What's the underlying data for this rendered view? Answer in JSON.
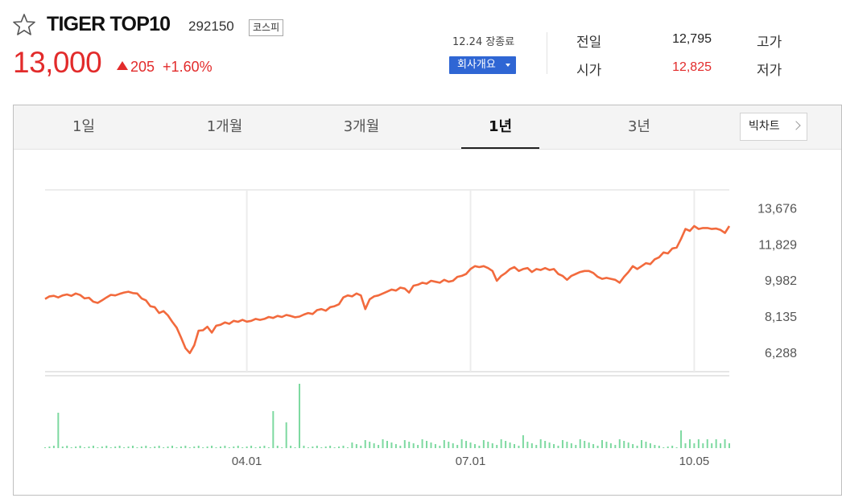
{
  "stock": {
    "name": "TIGER TOP10",
    "code": "292150",
    "market": "코스피",
    "price": "13,000",
    "change": "205",
    "change_rate": "+1.60%",
    "up_color": "#e22b2b"
  },
  "status": {
    "date_text": "12.24 장종료",
    "company_button": "회사개요"
  },
  "stats": {
    "prev_label": "전일",
    "prev_value": "12,795",
    "open_label": "시가",
    "open_value": "12,825",
    "high_label": "고가",
    "low_label": "저가"
  },
  "tabs": [
    {
      "label": "1일",
      "active": false
    },
    {
      "label": "1개월",
      "active": false
    },
    {
      "label": "3개월",
      "active": false
    },
    {
      "label": "1년",
      "active": true
    },
    {
      "label": "3년",
      "active": false
    }
  ],
  "bigchart_label": "빅차트",
  "chart_data": {
    "type": "line",
    "price_color": "#f26a3d",
    "volume_color": "#7dd9a0",
    "y_ticks": [
      "13,676",
      "11,829",
      "9,982",
      "8,135",
      "6,288"
    ],
    "y_tick_values": [
      13676,
      11829,
      9982,
      8135,
      6288
    ],
    "ylim": [
      5300,
      14600
    ],
    "x_tick_labels": [
      "04.01",
      "07.01",
      "10.05"
    ],
    "x_tick_index": [
      46,
      97,
      148
    ],
    "price": [
      9020,
      9150,
      9180,
      9100,
      9200,
      9250,
      9180,
      9300,
      9220,
      9050,
      9080,
      8880,
      8820,
      8950,
      9100,
      9230,
      9200,
      9280,
      9350,
      9390,
      9320,
      9300,
      9050,
      8950,
      8650,
      8600,
      8300,
      8400,
      8180,
      7850,
      7550,
      7050,
      6500,
      6250,
      6650,
      7400,
      7420,
      7600,
      7300,
      7650,
      7700,
      7820,
      7750,
      7900,
      7850,
      7950,
      7860,
      7900,
      8000,
      7950,
      8000,
      8100,
      8050,
      8150,
      8100,
      8200,
      8150,
      8080,
      8120,
      8220,
      8300,
      8250,
      8450,
      8500,
      8420,
      8600,
      8650,
      8750,
      9100,
      9200,
      9150,
      9300,
      9200,
      8500,
      9000,
      9150,
      9200,
      9300,
      9400,
      9500,
      9450,
      9600,
      9550,
      9350,
      9700,
      9750,
      9850,
      9800,
      9950,
      9900,
      9850,
      10000,
      9900,
      9950,
      10150,
      10200,
      10300,
      10550,
      10700,
      10650,
      10700,
      10600,
      10450,
      9950,
      10200,
      10350,
      10550,
      10650,
      10450,
      10550,
      10600,
      10400,
      10550,
      10500,
      10600,
      10500,
      10550,
      10300,
      10200,
      10000,
      10200,
      10300,
      10400,
      10450,
      10450,
      10350,
      10150,
      10050,
      10100,
      10050,
      10000,
      9850,
      10150,
      10400,
      10700,
      10550,
      10700,
      10850,
      10800,
      11050,
      11150,
      11400,
      11350,
      11600,
      11650,
      12100,
      12600,
      12500,
      12750,
      12600,
      12650,
      12650,
      12600,
      12620,
      12550,
      12400,
      12750
    ]
  }
}
